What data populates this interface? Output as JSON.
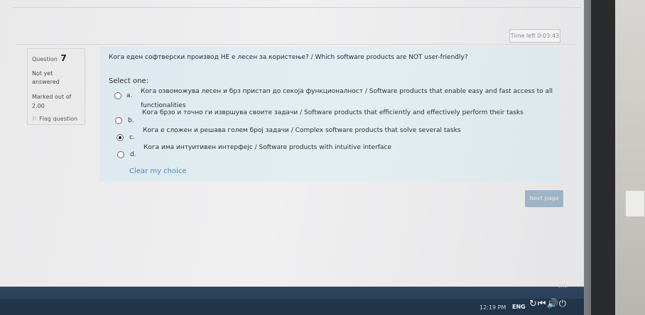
{
  "timer": {
    "label": "Time left 0:03:43"
  },
  "question_info": {
    "question_label": "Question",
    "question_number": "7",
    "state_line1": "Not yet",
    "state_line2": "answered",
    "marked_line1": "Marked out of",
    "marked_line2": "2.00",
    "flag_label": "Flag question"
  },
  "question": {
    "text": "Кога еден софтверски производ НЕ е лесен за користење? / Which software products are NOT user-friendly?",
    "select_label": "Select one:",
    "options": [
      {
        "letter": "a.",
        "line1": "Кога озвоможува лесен и брз пристап до секоја функционалност / Software products that enable easy and fast access to all",
        "line2": "functionalities",
        "selected": false
      },
      {
        "letter": "b.",
        "line1": "Кога брзо и точно ги извршува своите задачи / Software products that efficiently and effectively perform their tasks",
        "line2": "",
        "selected": false
      },
      {
        "letter": "c.",
        "line1": "Кога е сложен и решава голем број задачи / Complex software products that solve several tasks",
        "line2": "",
        "selected": true
      },
      {
        "letter": "d.",
        "line1": "Кога има интуитивен интерфејс / Software products with intuitive interface",
        "line2": "",
        "selected": false
      }
    ],
    "clear_label": "Clear my choice"
  },
  "navigation": {
    "next_label": "Next page"
  },
  "taskbar": {
    "lang_top": "ENG",
    "clock": "12:19 PM",
    "lang": "ENG"
  },
  "colors": {
    "question_bg": "#e0ecf0",
    "link": "#4f86b8",
    "next_button": "#9fb3c6",
    "taskbar": "#2b4059"
  }
}
